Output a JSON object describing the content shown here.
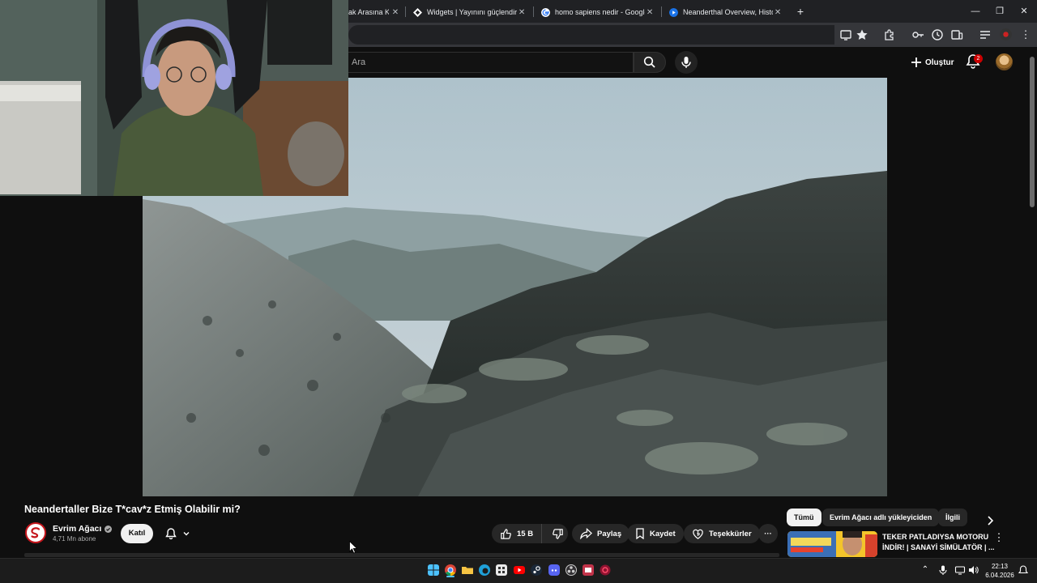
{
  "browser": {
    "tabs": [
      {
        "label": "ak Arasına Ko",
        "favicon": "generic-icon"
      },
      {
        "label": "Widgets | Yayınını güçlendirmek",
        "favicon": "widget-diamond-icon"
      },
      {
        "label": "homo sapiens nedir - Google'da",
        "favicon": "google-icon"
      },
      {
        "label": "Neanderthal Overview, History",
        "favicon": "play-icon"
      }
    ],
    "new_tab": "+",
    "window_controls": {
      "minimize": "—",
      "restore": "❐",
      "close": "✕"
    }
  },
  "youtube": {
    "search": {
      "placeholder": "Ara"
    },
    "create_label": "Oluştur",
    "notifications_count": "2",
    "video": {
      "title": "Neandertaller Bize T*cav*z Etmiş Olabilir mi?",
      "channel_name": "Evrim Ağacı",
      "subscribers": "4,71 Mn abone",
      "join_label": "Katıl",
      "likes": "15 B",
      "share_label": "Paylaş",
      "save_label": "Kaydet",
      "thanks_label": "Teşekkürler",
      "more_label": "···"
    },
    "filter_chips": [
      "Tümü",
      "Evrim Ağacı adlı yükleyiciden",
      "İlgili"
    ],
    "recommendation": {
      "title": "TEKER PATLADIYSA MOTORU İNDİR! | SANAYİ SİMÜLATÖR | ..."
    }
  },
  "taskbar": {
    "time": "22:13",
    "date": "6.04.2026"
  },
  "colors": {
    "background": "#0f0f0f",
    "chrome_bar": "#202124",
    "accent_red": "#cc0000",
    "pill": "#272727"
  }
}
